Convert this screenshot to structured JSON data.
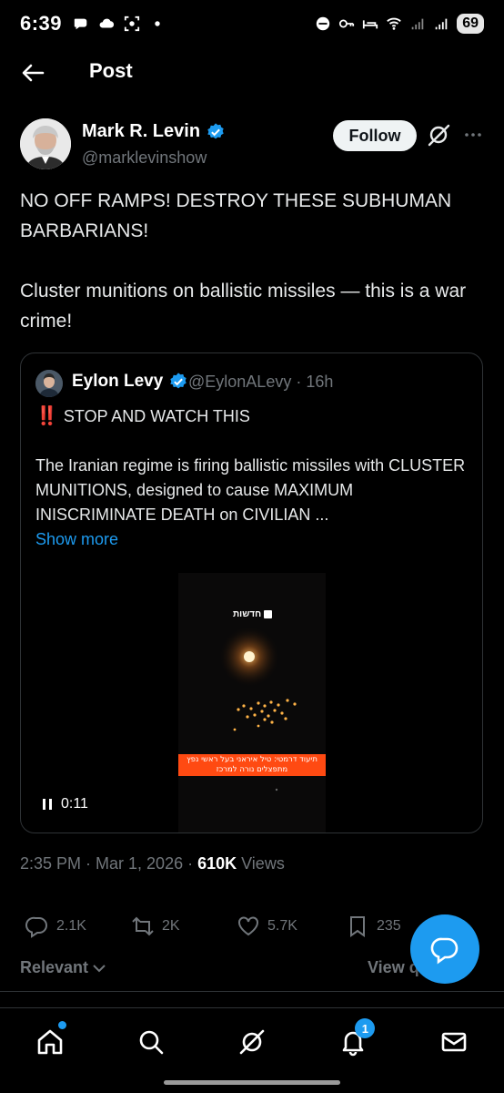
{
  "status_bar": {
    "time": "6:39",
    "battery": "69"
  },
  "header": {
    "title": "Post"
  },
  "post": {
    "author_name": "Mark R. Levin",
    "author_handle": "@marklevinshow",
    "follow_label": "Follow",
    "text_paragraphs": [
      "NO OFF RAMPS! DESTROY THESE SUBHUMAN BARBARIANS!",
      "Cluster munitions on ballistic missiles — this is a war crime!"
    ],
    "timestamp": "2:35 PM · Mar 1, 2026 · ",
    "views_count": "610K",
    "views_label": " Views"
  },
  "quote": {
    "author_name": "Eylon Levy",
    "author_handle": "@EylonALevy · 16h",
    "line1_emoji": "‼️",
    "line1": "STOP AND WATCH THIS",
    "body": "The Iranian regime is firing ballistic missiles with CLUSTER MUNITIONS, designed to cause MAXIMUM INISCRIMINATE DEATH on CIVILIAN ...",
    "show_more": "Show more",
    "video": {
      "logo_text": "חדשות",
      "caption": "תיעוד דרמטי: טיל איראני בעל ראשי נפץ מתפצלים נורה למרכז",
      "time": "0:11"
    }
  },
  "actions": {
    "replies": "2.1K",
    "reposts": "2K",
    "likes": "5.7K",
    "bookmarks": "235"
  },
  "sort": {
    "relevant": "Relevant",
    "view_quotes": "View q"
  },
  "nav": {
    "notifications_badge": "1"
  },
  "colors": {
    "accent": "#1d9bf0",
    "background": "#000000",
    "secondary_text": "#71767b",
    "video_caption": "#ff4a12"
  }
}
